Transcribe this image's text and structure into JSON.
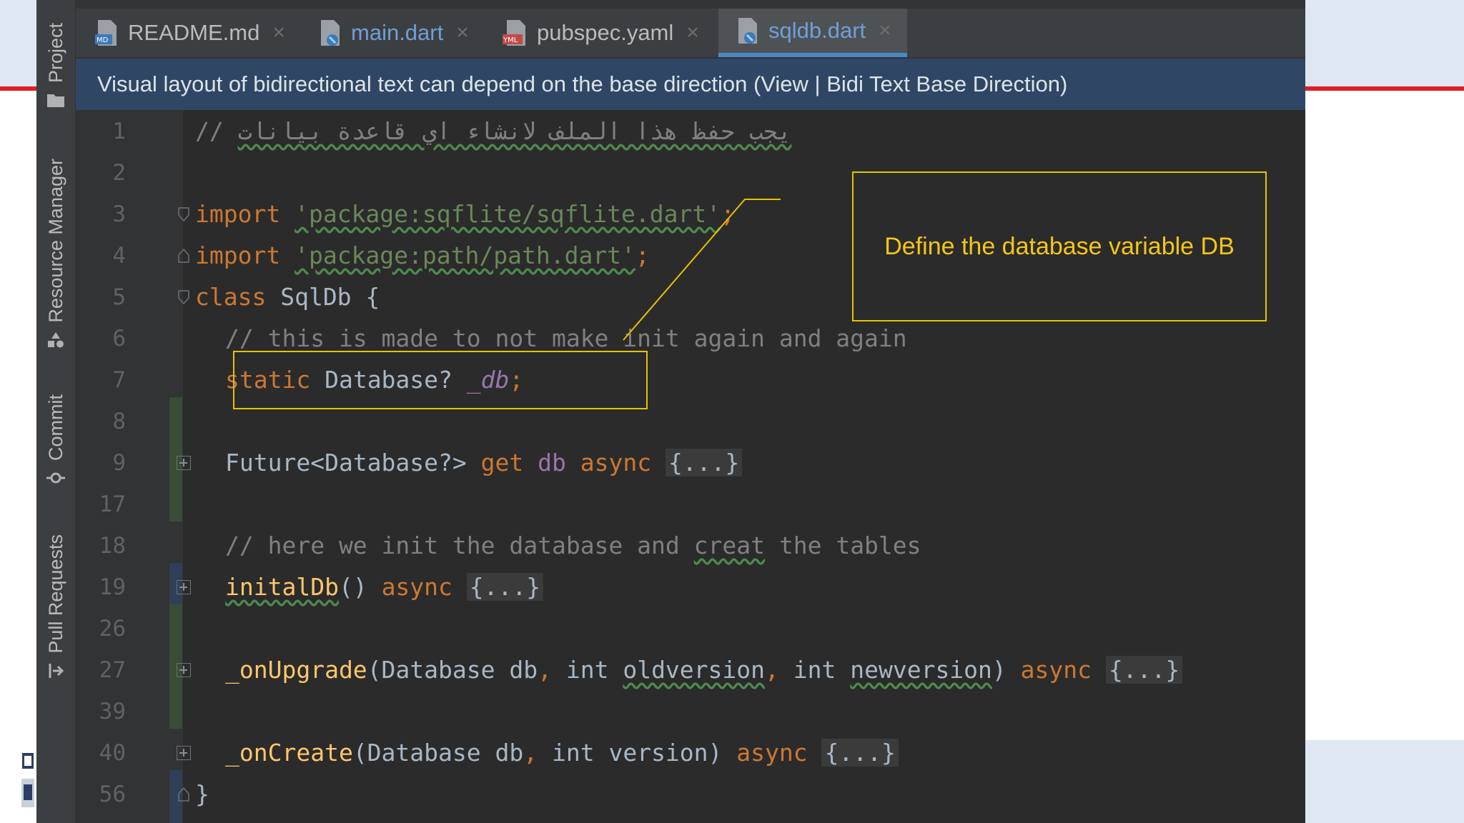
{
  "tabs": [
    {
      "label": "README.md",
      "icon": "markdown-file-icon",
      "color": "#bbbbbb"
    },
    {
      "label": "main.dart",
      "icon": "dart-file-icon",
      "color": "#6f9fd8"
    },
    {
      "label": "pubspec.yaml",
      "icon": "yaml-file-icon",
      "color": "#bbbbbb"
    },
    {
      "label": "sqldb.dart",
      "icon": "dart-file-icon",
      "color": "#6f9fd8",
      "active": true
    }
  ],
  "close_glyph": "×",
  "sidebar": {
    "project": "Project",
    "resource_manager": "Resource Manager",
    "commit": "Commit",
    "pull_requests": "Pull Requests"
  },
  "banner": {
    "text": "Visual layout of bidirectional text can depend on the base direction (View | Bidi Text Base Direction)"
  },
  "code": {
    "line_numbers": [
      "1",
      "2",
      "3",
      "4",
      "5",
      "6",
      "7",
      "8",
      "9",
      "17",
      "18",
      "19",
      "26",
      "27",
      "39",
      "40",
      "56"
    ],
    "l1_comment_prefix": "// ",
    "l1_comment_arabic": "يجب حفظ هذا الملف لانشاء اي قاعدة بيانات",
    "l3_import": "import",
    "l3_string": "'package:sqflite/sqflite.dart'",
    "semicolon": ";",
    "l4_import": "import",
    "l4_string": "'package:path/path.dart'",
    "l5_class": "class",
    "l5_name": " SqlDb {",
    "l6_comment": "// this is made to not make init again and again",
    "l7_static": "static",
    "l7_type": " Database? ",
    "l7_field": "_db",
    "l9_future": "Future<Database?> ",
    "l9_get": "get",
    "l9_db": " db ",
    "l9_async": "async",
    "folded": "{...}",
    "l18_comment_a": "// here we init the database and ",
    "l18_comment_b": "creat",
    "l18_comment_c": " the tables",
    "l19_fn": "initalDb",
    "l19_parens": "() ",
    "async": "async",
    "l27_fn": "_onUpgrade",
    "l27_sig_a": "(Database db",
    "comma": ",",
    "l27_int1": " int ",
    "l27_p1": "oldversion",
    "l27_int2": " int ",
    "l27_p2": "newversion",
    "l27_close": ") ",
    "l40_fn": "_onCreate",
    "l40_sig_a": "(Database db",
    "l40_sig_b": " int version) ",
    "closing_brace": "}"
  },
  "annotation": {
    "text": "Define the database variable DB",
    "color": "#f5c518"
  },
  "colors": {
    "keyword": "#cc7832",
    "string": "#6a8759",
    "comment": "#808080",
    "field": "#9876aa",
    "function": "#ffc66d",
    "accent_red": "#e31b23"
  }
}
